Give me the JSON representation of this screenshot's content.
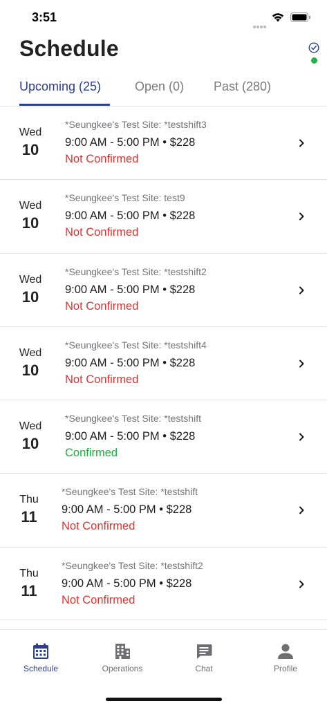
{
  "status_bar": {
    "time": "3:51"
  },
  "header": {
    "title": "Schedule"
  },
  "tabs": [
    {
      "label": "Upcoming (25)",
      "active": true
    },
    {
      "label": "Open (0)",
      "active": false
    },
    {
      "label": "Past (280)",
      "active": false
    }
  ],
  "shifts": [
    {
      "day": "Wed",
      "date": "10",
      "site": "*Seungkee's Test Site: *testshift3",
      "time": "9:00 AM - 5:00 PM • $228",
      "status": "Not Confirmed"
    },
    {
      "day": "Wed",
      "date": "10",
      "site": "*Seungkee's Test Site: test9",
      "time": "9:00 AM - 5:00 PM • $228",
      "status": "Not Confirmed"
    },
    {
      "day": "Wed",
      "date": "10",
      "site": "*Seungkee's Test Site: *testshift2",
      "time": "9:00 AM - 5:00 PM • $228",
      "status": "Not Confirmed"
    },
    {
      "day": "Wed",
      "date": "10",
      "site": "*Seungkee's Test Site: *testshift4",
      "time": "9:00 AM - 5:00 PM • $228",
      "status": "Not Confirmed"
    },
    {
      "day": "Wed",
      "date": "10",
      "site": "*Seungkee's Test Site: *testshift",
      "time": "9:00 AM - 5:00 PM • $228",
      "status": "Confirmed"
    },
    {
      "day": "Thu",
      "date": "11",
      "site": "*Seungkee's Test Site: *testshift",
      "time": "9:00 AM - 5:00 PM • $228",
      "status": "Not Confirmed"
    },
    {
      "day": "Thu",
      "date": "11",
      "site": "*Seungkee's Test Site: *testshift2",
      "time": "9:00 AM - 5:00 PM • $228",
      "status": "Not Confirmed"
    }
  ],
  "bottom_nav": [
    {
      "label": "Schedule",
      "icon": "calendar-icon",
      "active": true
    },
    {
      "label": "Operations",
      "icon": "building-icon",
      "active": false
    },
    {
      "label": "Chat",
      "icon": "chat-icon",
      "active": false
    },
    {
      "label": "Profile",
      "icon": "person-icon",
      "active": false
    }
  ],
  "colors": {
    "accent": "#2a3f8f",
    "not_confirmed": "#e03131",
    "confirmed": "#17b33a",
    "online": "#22b24c"
  }
}
